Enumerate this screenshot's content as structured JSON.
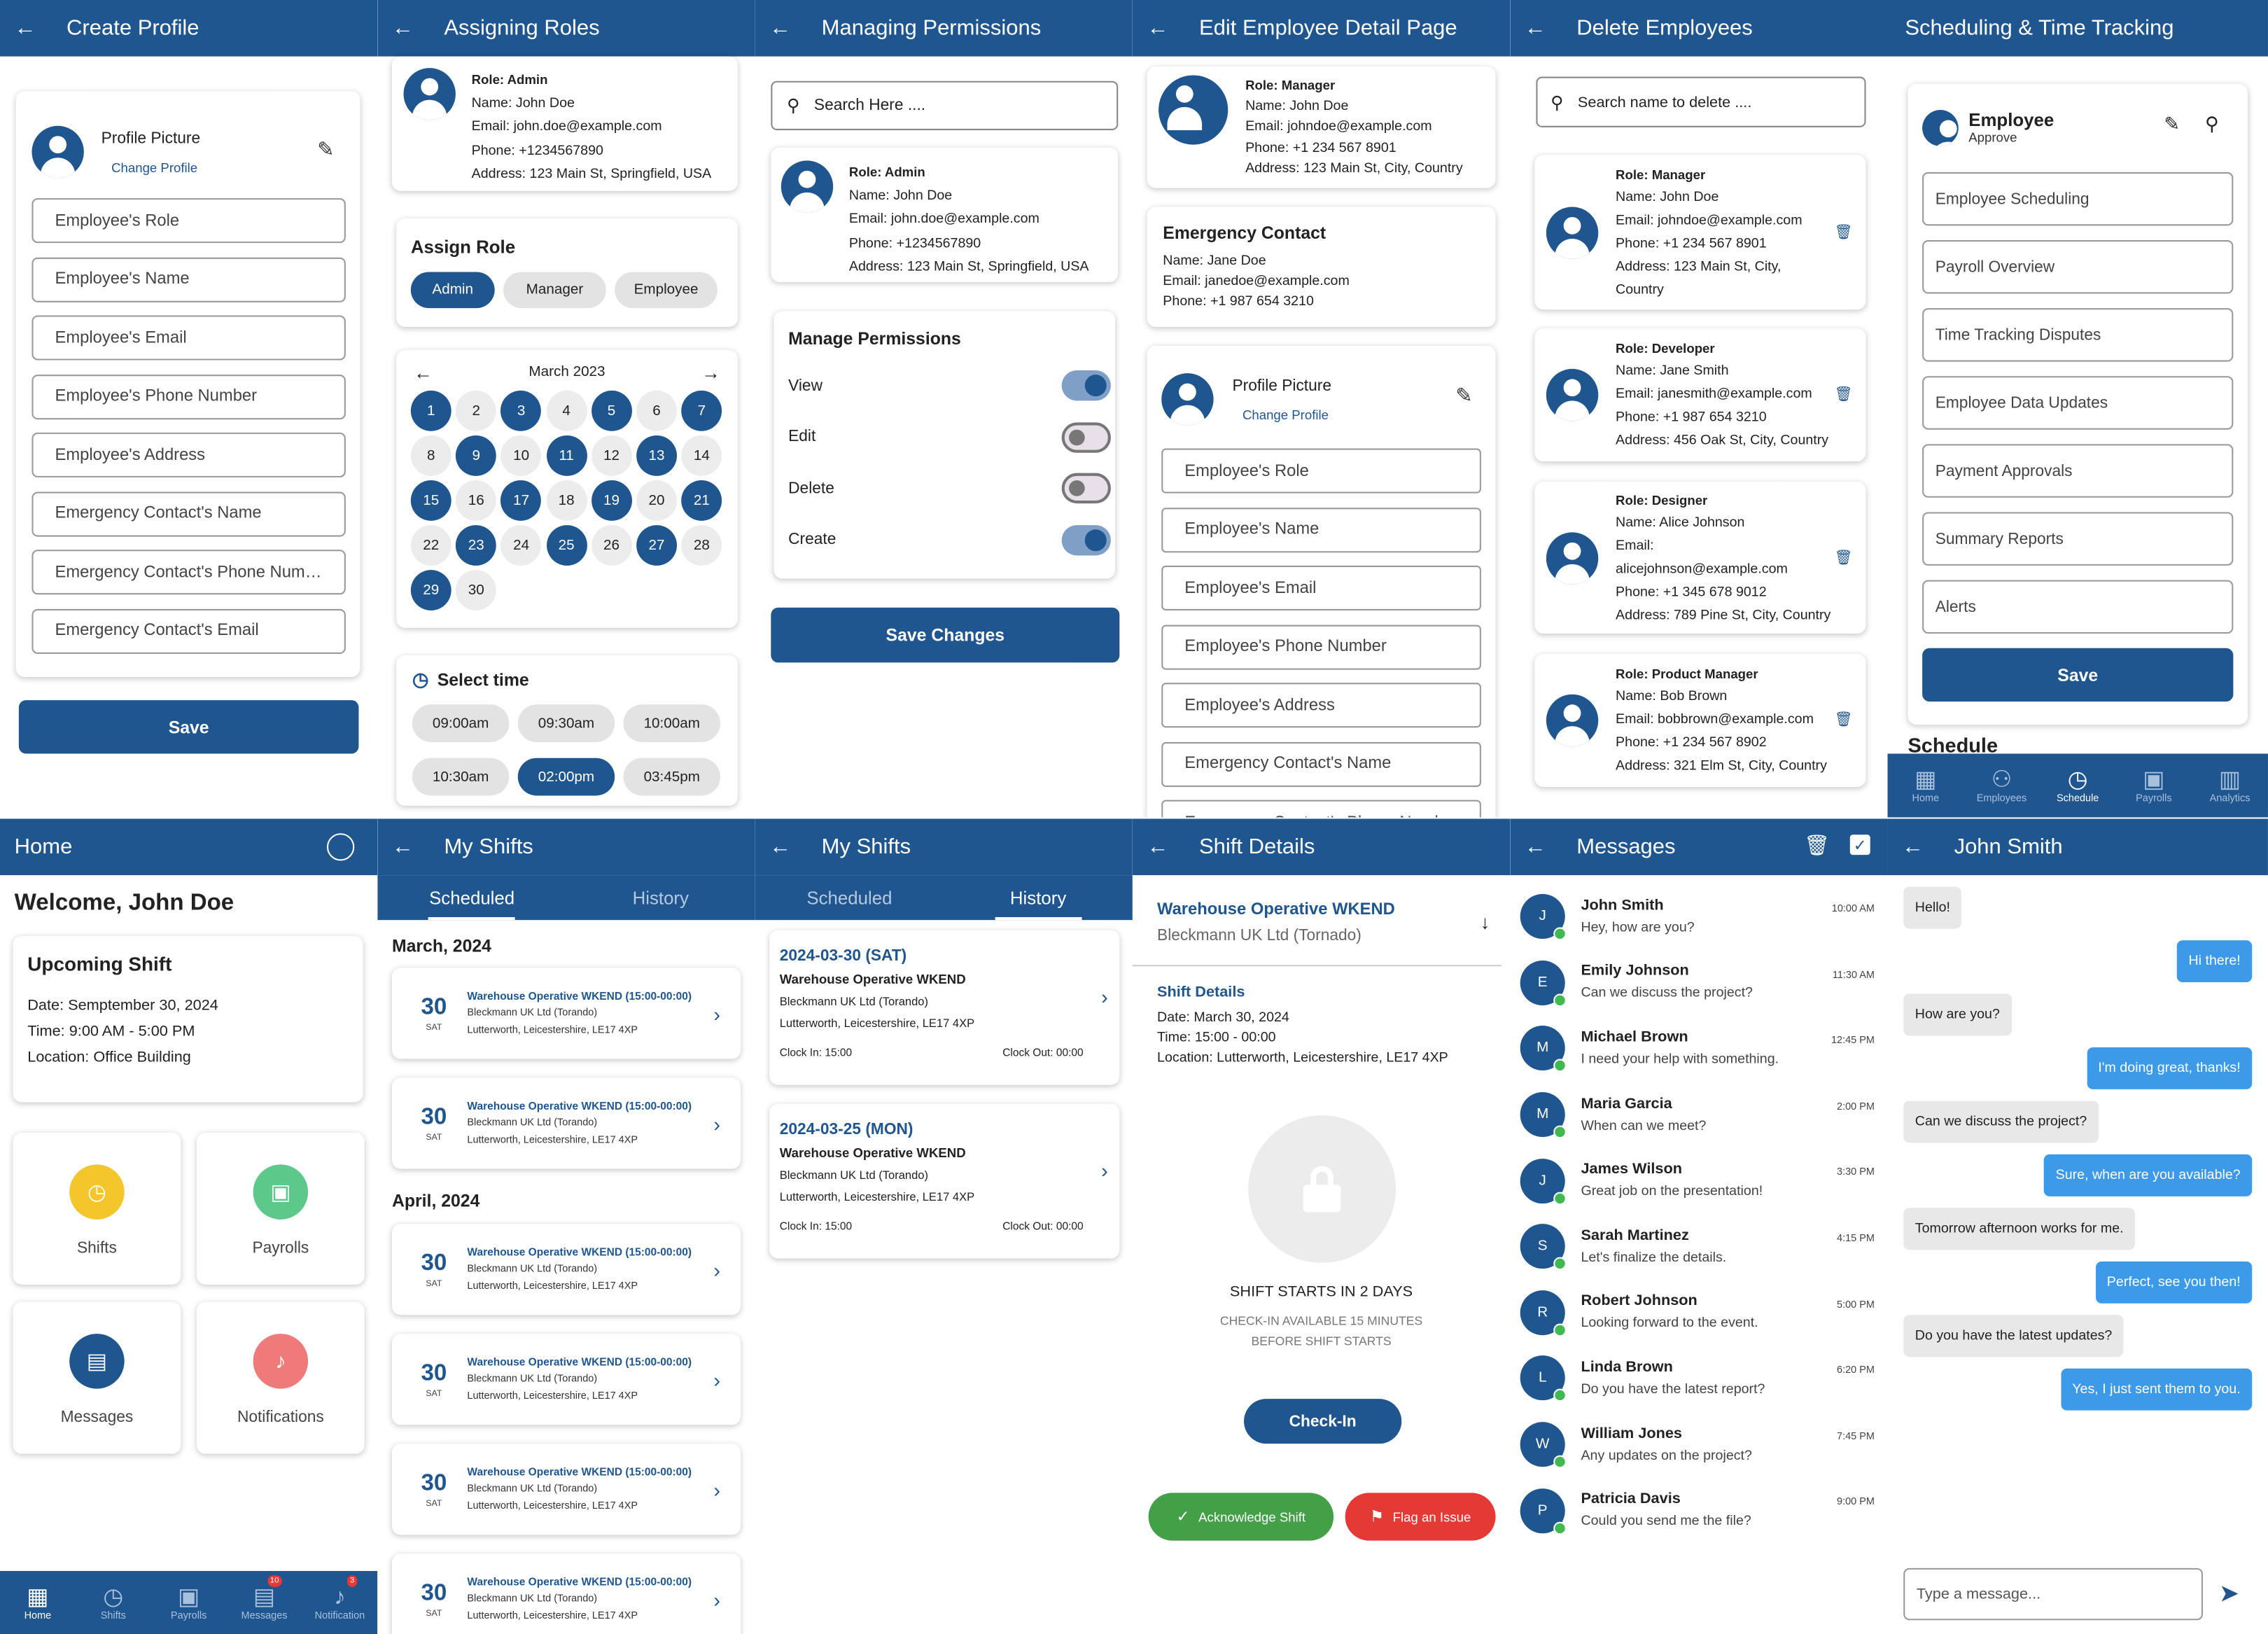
{
  "create_profile": {
    "title": "Create Profile",
    "profile_picture": "Profile Picture",
    "change_profile": "Change Profile",
    "fields": [
      "Employee's Role",
      "Employee's Name",
      "Employee's Email",
      "Employee's Phone Number",
      "Employee's Address",
      "Emergency Contact's Name",
      "Emergency Contact's Phone Num…",
      "Emergency Contact's Email"
    ],
    "save": "Save"
  },
  "assigning_roles": {
    "title": "Assigning Roles",
    "role": "Role: Admin",
    "name": "Name: John Doe",
    "email": "Email: john.doe@example.com",
    "phone": "Phone: +1234567890",
    "address": "Address: 123 Main St, Springfield, USA",
    "assign_role": "Assign Role",
    "roles": [
      "Admin",
      "Manager",
      "Employee"
    ],
    "month": "March 2023",
    "days": [
      "1",
      "2",
      "3",
      "4",
      "5",
      "6",
      "7",
      "8",
      "9",
      "10",
      "11",
      "12",
      "13",
      "14",
      "15",
      "16",
      "17",
      "18",
      "19",
      "20",
      "21",
      "22",
      "23",
      "24",
      "25",
      "26",
      "27",
      "28",
      "29",
      "30"
    ],
    "select_time": "Select time",
    "times": [
      "09:00am",
      "09:30am",
      "10:00am",
      "10:30am",
      "02:00pm",
      "03:45pm"
    ]
  },
  "managing_permissions": {
    "title": "Managing Permissions",
    "search": "Search Here ....",
    "role": "Role: Admin",
    "name": "Name: John Doe",
    "email": "Email: john.doe@example.com",
    "phone": "Phone: +1234567890",
    "address": "Address: 123 Main St, Springfield, USA",
    "manage": "Manage Permissions",
    "perms": [
      "View",
      "Edit",
      "Delete",
      "Create"
    ],
    "save": "Save Changes"
  },
  "edit_employee": {
    "title": "Edit Employee Detail Page",
    "role": "Role: Manager",
    "name": "Name: John Doe",
    "email": "Email: johndoe@example.com",
    "phone": "Phone: +1 234 567 8901",
    "address": "Address: 123 Main St, City, Country",
    "ec_title": "Emergency Contact",
    "ec_name": "Name: Jane Doe",
    "ec_email": "Email: janedoe@example.com",
    "ec_phone": "Phone: +1 987 654 3210",
    "profile_picture": "Profile Picture",
    "change_profile": "Change Profile",
    "fields": [
      "Employee's Role",
      "Employee's Name",
      "Employee's Email",
      "Employee's Phone Number",
      "Employee's Address",
      "Emergency Contact's Name",
      "Emergency Contact's Phone Number"
    ]
  },
  "delete_employees": {
    "title": "Delete Employees",
    "search": "Search name to delete ....",
    "people": [
      {
        "role": "Role: Manager",
        "name": "Name: John Doe",
        "email": "Email: johndoe@example.com",
        "phone": "Phone: +1 234 567 8901",
        "address1": "Address: 123 Main St, City,",
        "address2": "Country"
      },
      {
        "role": "Role: Developer",
        "name": "Name: Jane Smith",
        "email": "Email: janesmith@example.com",
        "phone": "Phone: +1 987 654 3210",
        "address1": "Address: 456 Oak St, City, Country",
        "address2": ""
      },
      {
        "role": "Role: Designer",
        "name": "Name: Alice Johnson",
        "email": "Email:",
        "email2": "alicejohnson@example.com",
        "phone": "Phone: +1 345 678 9012",
        "address1": "Address: 789 Pine St, City, Country",
        "address2": ""
      },
      {
        "role": "Role: Product Manager",
        "name": "Name: Bob Brown",
        "email": "Email: bobbrown@example.com",
        "phone": "Phone: +1 234 567 8902",
        "address1": "Address: 321 Elm St, City, Country",
        "address2": ""
      }
    ]
  },
  "scheduling": {
    "title": "Scheduling & Time Tracking",
    "employee": "Employee",
    "approve": "Approve",
    "items": [
      "Employee Scheduling",
      "Payroll Overview",
      "Time Tracking Disputes",
      "Employee Data Updates",
      "Payment Approvals",
      "Summary Reports",
      "Alerts"
    ],
    "save": "Save",
    "peek": "Schedule",
    "nav": [
      "Home",
      "Employees",
      "Schedule",
      "Payrolls",
      "Analytics"
    ]
  },
  "home": {
    "title": "Home",
    "welcome": "Welcome, John Doe",
    "upcoming": "Upcoming Shift",
    "date": "Date: Semptember 30, 2024",
    "time": "Time: 9:00 AM - 5:00 PM",
    "location": "Location: Office Building",
    "tiles": [
      "Shifts",
      "Payrolls",
      "Messages",
      "Notifications"
    ],
    "nav": [
      "Home",
      "Shifts",
      "Payrolls",
      "Messages",
      "Notification"
    ],
    "badge_messages": "10",
    "badge_notif": "3"
  },
  "my_shifts": {
    "title": "My Shifts",
    "tabs": [
      "Scheduled",
      "History"
    ],
    "march": "March, 2024",
    "april": "April, 2024",
    "day": "30",
    "dow": "SAT",
    "shift_title": "Warehouse Operative WKEND (15:00-00:00)",
    "company": "Bleckmann UK Ltd (Torando)",
    "address": "Lutterworth, Leicestershire, LE17 4XP"
  },
  "history": {
    "title": "My Shifts",
    "tabs": [
      "Scheduled",
      "History"
    ],
    "items": [
      {
        "date": "2024-03-30 (SAT)",
        "title": "Warehouse Operative WKEND",
        "company": "Bleckmann UK Ltd (Torando)",
        "address": "Lutterworth, Leicestershire, LE17 4XP",
        "in": "Clock In: 15:00",
        "out": "Clock Out: 00:00"
      },
      {
        "date": "2024-03-25 (MON)",
        "title": "Warehouse Operative WKEND",
        "company": "Bleckmann UK Ltd (Torando)",
        "address": "Lutterworth, Leicestershire, LE17 4XP",
        "in": "Clock In: 15:00",
        "out": "Clock Out: 00:00"
      }
    ]
  },
  "shift_details": {
    "title": "Shift Details",
    "job": "Warehouse Operative WKEND",
    "company": "Bleckmann UK Ltd (Tornado)",
    "section": "Shift Details",
    "date": "Date: March 30, 2024",
    "time": "Time: 15:00 - 00:00",
    "location": "Location: Lutterworth, Leicestershire, LE17 4XP",
    "starts": "SHIFT STARTS IN 2 DAYS",
    "checkin_note1": "CHECK-IN AVAILABLE 15 MINUTES",
    "checkin_note2": "BEFORE SHIFT STARTS",
    "checkin": "Check-In",
    "ack": "Acknowledge Shift",
    "flag": "Flag an Issue"
  },
  "messages": {
    "title": "Messages",
    "list": [
      {
        "i": "J",
        "name": "John Smith",
        "text": "Hey, how are you?",
        "time": "10:00 AM"
      },
      {
        "i": "E",
        "name": "Emily Johnson",
        "text": "Can we discuss the project?",
        "time": "11:30 AM"
      },
      {
        "i": "M",
        "name": "Michael Brown",
        "text": "I need your help with something.",
        "time": "12:45 PM"
      },
      {
        "i": "M",
        "name": "Maria Garcia",
        "text": "When can we meet?",
        "time": "2:00 PM"
      },
      {
        "i": "J",
        "name": "James Wilson",
        "text": "Great job on the presentation!",
        "time": "3:30 PM"
      },
      {
        "i": "S",
        "name": "Sarah Martinez",
        "text": "Let's finalize the details.",
        "time": "4:15 PM"
      },
      {
        "i": "R",
        "name": "Robert Johnson",
        "text": "Looking forward to the event.",
        "time": "5:00 PM"
      },
      {
        "i": "L",
        "name": "Linda Brown",
        "text": "Do you have the latest report?",
        "time": "6:20 PM"
      },
      {
        "i": "W",
        "name": "William Jones",
        "text": "Any updates on the project?",
        "time": "7:45 PM"
      },
      {
        "i": "P",
        "name": "Patricia Davis",
        "text": "Could you send me the file?",
        "time": "9:00 PM"
      }
    ]
  },
  "chat": {
    "title": "John Smith",
    "bubbles": [
      {
        "dir": "in",
        "text": "Hello!"
      },
      {
        "dir": "out",
        "text": "Hi there!"
      },
      {
        "dir": "in",
        "text": "How are you?"
      },
      {
        "dir": "out",
        "text": "I'm doing great, thanks!"
      },
      {
        "dir": "in",
        "text": "Can we discuss the project?"
      },
      {
        "dir": "out",
        "text": "Sure, when are you available?"
      },
      {
        "dir": "in",
        "text": "Tomorrow afternoon works for me."
      },
      {
        "dir": "out",
        "text": "Perfect, see you then!"
      },
      {
        "dir": "in",
        "text": "Do you have the latest updates?"
      },
      {
        "dir": "out",
        "text": "Yes, I just sent them to you."
      }
    ],
    "placeholder": "Type a message..."
  },
  "colors": {
    "primary": "#1f5690",
    "accent_blue": "#3d9ae8",
    "green": "#43a047",
    "red": "#e53935",
    "yellow": "#f4c62c",
    "mint": "#5cc98a",
    "salmon": "#f07a7a"
  }
}
